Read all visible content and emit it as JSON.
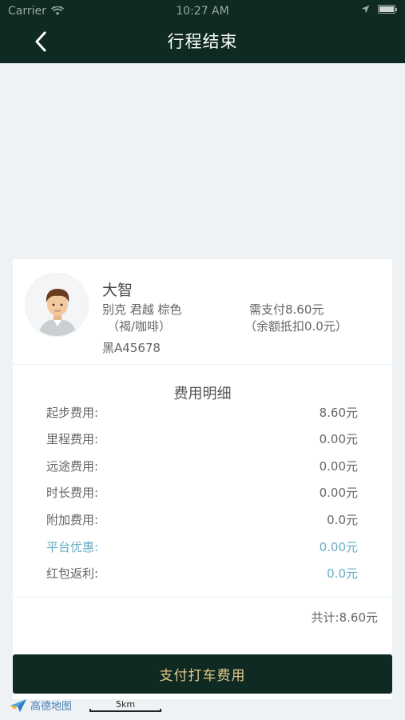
{
  "status_bar": {
    "carrier": "Carrier",
    "time": "10:27 AM"
  },
  "nav": {
    "title": "行程结束"
  },
  "driver": {
    "name": "大智",
    "car_model": "别克 君越 棕色",
    "car_color_note": "（褐/咖啡）",
    "plate": "黑A45678",
    "pay_required": "需支付8.60元",
    "pay_note": "（余额抵扣0.0元）"
  },
  "fees": {
    "title": "费用明细",
    "rows": [
      {
        "label": "起步费用:",
        "value": "8.60元"
      },
      {
        "label": "里程费用:",
        "value": "0.00元"
      },
      {
        "label": "远途费用:",
        "value": "0.00元"
      },
      {
        "label": "时长费用:",
        "value": "0.00元"
      },
      {
        "label": "附加费用:",
        "value": "0.0元"
      },
      {
        "label": "平台优惠:",
        "value": "0.00元"
      },
      {
        "label": "红包返利:",
        "value": "0.0元"
      }
    ],
    "total": "共计:8.60元"
  },
  "pay_button": {
    "label": "支付打车费用"
  },
  "map": {
    "logo_text": "高德地图",
    "scale_label": "5km"
  },
  "colors": {
    "header_bg": "#0e2a22",
    "button_text": "#e3c98a",
    "discount": "#66adc4",
    "page_bg": "#eef2f4"
  }
}
